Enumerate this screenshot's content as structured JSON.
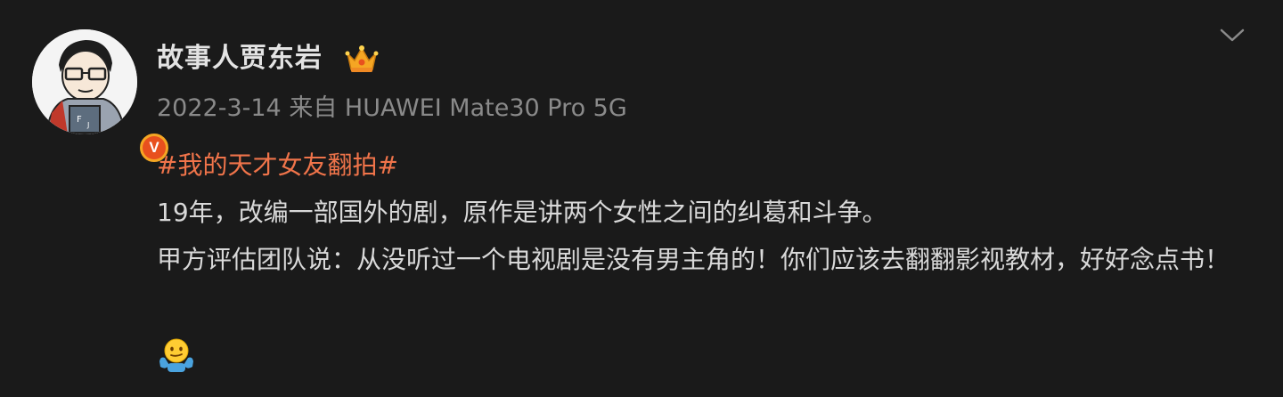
{
  "post": {
    "username": "故事人贾东岩",
    "date": "2022-3-14",
    "source_prefix": "来自",
    "device": "HUAWEI Mate30 Pro 5G",
    "hashtag": "#我的天才女友翻拍#",
    "paragraphs": [
      "19年，改编一部国外的剧，原作是讲两个女性之间的纠葛和斗争。",
      "甲方评估团队说：从没听过一个电视剧是没有男主角的！你们应该去翻翻影视教材，好好念点书！"
    ],
    "badge_letter": "V"
  },
  "colors": {
    "background": "#1a1a1a",
    "hashtag": "#f0744a",
    "meta": "#8a8a8a",
    "username": "#e3e3e3",
    "badge": "#f5a623"
  },
  "icons": {
    "menu": "chevron-down-icon",
    "membership": "crown-icon",
    "verified": "verified-badge-icon",
    "emoji": "shrug-emoji-icon"
  }
}
